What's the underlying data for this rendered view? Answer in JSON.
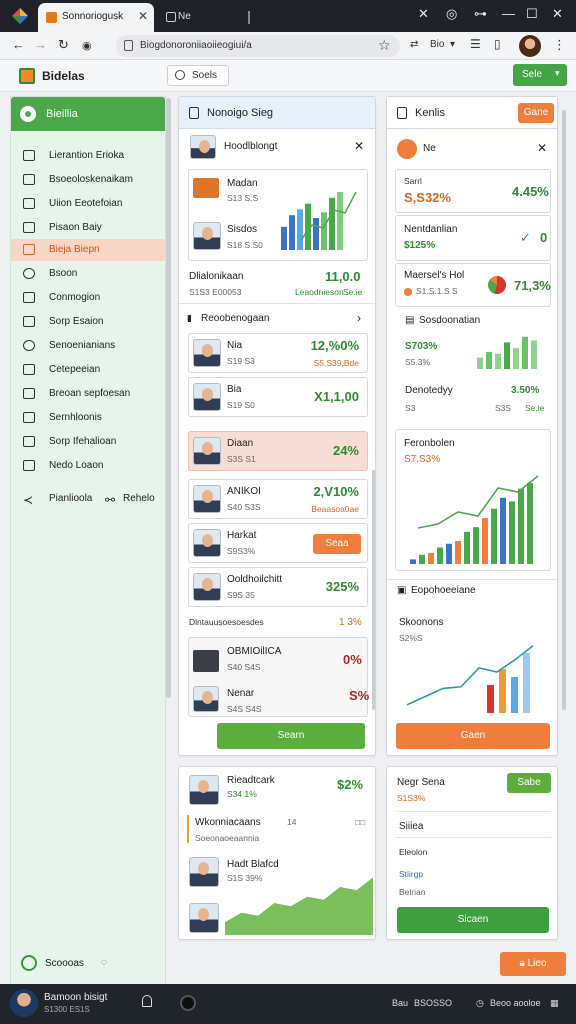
{
  "browser": {
    "tab_title": "Sonnoriogusk",
    "tab2_title": "Ne",
    "url": "Biogdonoroniiaoiieogiui/a",
    "omnibox_extra": "Bio"
  },
  "app": {
    "brand": "Bidelas",
    "search_label": "Soels",
    "header_button": "Sele"
  },
  "sidebar": {
    "header": "Bieillia",
    "items": [
      {
        "label": "Lierantion Erioka",
        "icon": "edit-icon"
      },
      {
        "label": "Bsoeoloskenaikam",
        "icon": "list-icon"
      },
      {
        "label": "Uiion Eeotefoian",
        "icon": "shield-icon"
      },
      {
        "label": "Pisaon Baiy",
        "icon": "square-icon"
      },
      {
        "label": "Bieja Biepn",
        "icon": "edit-icon"
      },
      {
        "label": "Bsoon",
        "icon": "circle-icon"
      },
      {
        "label": "Conmogion",
        "icon": "list-icon"
      },
      {
        "label": "Sorp Esaion",
        "icon": "square-icon"
      },
      {
        "label": "Senoenianians",
        "icon": "circle-icon"
      },
      {
        "label": "Cetepeeian",
        "icon": "edit-icon"
      },
      {
        "label": "Breoan sepfoesan",
        "icon": "list-icon"
      },
      {
        "label": "Sernhloonis",
        "icon": "square-icon"
      },
      {
        "label": "Sorp Ifehalioan",
        "icon": "list-icon"
      },
      {
        "label": "Nedo Loaon",
        "icon": "square-icon"
      }
    ],
    "active_index": 4,
    "footer_left": "Pianlioola",
    "footer_right": "Rehelo",
    "bottom_label": "Scoooas"
  },
  "col1": {
    "title": "Nonoigo Sieg",
    "profile_card": {
      "name": "Hoodlblongt"
    },
    "summary": {
      "row1_label": "Madan",
      "row1_sub": "S13 S.S",
      "row2_label": "Sisdos",
      "row2_sub": "S18 S.S0",
      "footer_label": "Dlialonikaan",
      "footer_sub": "S1S3 E00053",
      "footer_value": "11,0.0",
      "footer_link": "Leaodnieson",
      "footer_link2": "Se.ie"
    },
    "section_title": "Reoobenogaan",
    "rows": [
      {
        "name": "Nia",
        "sub": "S19 S3",
        "value": "12,%0%",
        "sub2": "S5,S39,Bde"
      },
      {
        "name": "Bia",
        "sub": "S19 S0",
        "value": "X1,1,00"
      },
      {
        "name": "Diaan",
        "sub": "S3S S1",
        "value": "24%"
      },
      {
        "name": "ANIKOI",
        "sub": "S40 S3S",
        "value": "2,V10%",
        "sub2": "Beaasoa0ae"
      },
      {
        "name": "Harkat",
        "sub": "S9S3%",
        "button": "Seaa"
      },
      {
        "name": "Ooldhoilchitt",
        "sub": "S9S 35",
        "value": "325%"
      }
    ],
    "divider_label": "Dlntauusoesoesdes",
    "divider_value": "1 3%",
    "rows2": [
      {
        "name": "OBMIOilICA",
        "sub": "S40 S4S",
        "value": "0%"
      },
      {
        "name": "Nenar",
        "sub": "S4S S4S",
        "value": "S%"
      }
    ],
    "button": "Searn"
  },
  "col2": {
    "title": "Kenlis",
    "title_button": "Gane",
    "sub_card_title": "Ne",
    "stats": [
      {
        "label": "Sarrl",
        "value": "S,S32%",
        "right": "4.45%"
      },
      {
        "label": "Nentdanlian",
        "value": "$125%",
        "right": "0"
      },
      {
        "label": "Maersel's Hol",
        "sub": "S1.S.1.S S",
        "right": "71,3%"
      }
    ],
    "section_title": "Sosdoonatian",
    "mini_value": "S703%",
    "mini_sub": "S5.3%",
    "desc_label": "Denotedyy",
    "desc_value": "3.50%",
    "desc_sub1": "S3",
    "desc_sub2": "S3S",
    "desc_sub3": "Se.ie",
    "chart_card_title": "Feronbolen",
    "chart_card_value": "S7.S3%",
    "section2_title": "Eopohoeeiane",
    "chart2_title": "Skoonons",
    "chart2_sub": "S2%S",
    "button": "Gaen"
  },
  "col1b": {
    "name": "Rieadtcark",
    "sub": "S34 1%",
    "value": "$2%",
    "sub_title": "Wkonniacaans",
    "sub_title_value": "14",
    "sub_line": "Soeonaoeaannia",
    "row_name": "Hadt Blafcd",
    "row_sub": "S1S 39%"
  },
  "col2b": {
    "name": "Negr Sena",
    "sub": "S1S3%",
    "button": "Sabe",
    "l1": "Siiiea",
    "l2": "Eleolon",
    "l3": "Stiirgp",
    "l4": "Belrian",
    "cta": "Sicaen"
  },
  "floating_button": "Lieo",
  "taskbar": {
    "user": "Bamoon bisigt",
    "sub": "S1300 ES1S",
    "right1": "Bau",
    "right2": "BSOSSO",
    "right3": "Beoo aooloe"
  },
  "colors": {
    "accent_green": "#4aa74a",
    "accent_orange": "#ef7d3b",
    "active_item": "#f8d6c6"
  },
  "chart_data": [
    {
      "type": "bar",
      "values": [
        0.3,
        0.5,
        0.4,
        0.6,
        0.7,
        0.8,
        0.55,
        0.65,
        0.9,
        1.0
      ]
    },
    {
      "type": "line",
      "values": [
        0.1,
        0.15,
        0.3,
        0.25,
        0.6,
        0.55,
        0.75
      ]
    }
  ]
}
